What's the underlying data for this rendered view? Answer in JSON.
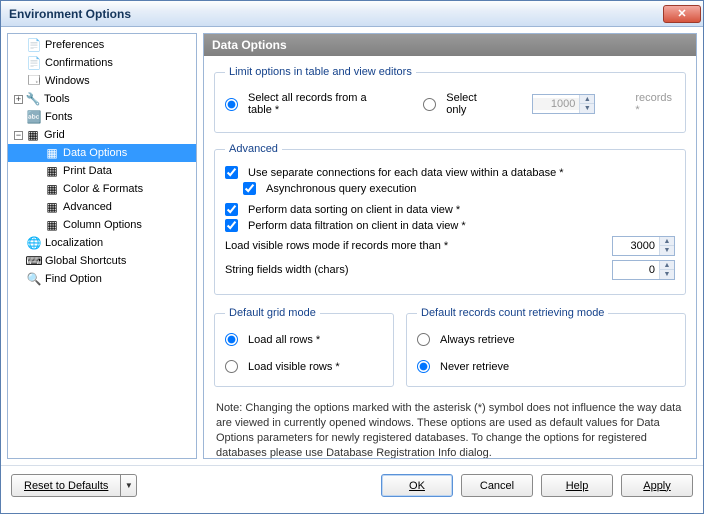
{
  "window": {
    "title": "Environment Options"
  },
  "tree": {
    "items": [
      {
        "label": "Preferences",
        "level": 0,
        "twist": "",
        "icon": "📄"
      },
      {
        "label": "Confirmations",
        "level": 0,
        "twist": "",
        "icon": "📄"
      },
      {
        "label": "Windows",
        "level": 0,
        "twist": "",
        "icon": "🗔"
      },
      {
        "label": "Tools",
        "level": 0,
        "twist": "+",
        "icon": "🔧"
      },
      {
        "label": "Fonts",
        "level": 0,
        "twist": "",
        "icon": "🔤"
      },
      {
        "label": "Grid",
        "level": 0,
        "twist": "−",
        "icon": "▦"
      },
      {
        "label": "Data Options",
        "level": 1,
        "twist": "",
        "icon": "▦",
        "selected": true
      },
      {
        "label": "Print Data",
        "level": 1,
        "twist": "",
        "icon": "▦"
      },
      {
        "label": "Color & Formats",
        "level": 1,
        "twist": "",
        "icon": "▦"
      },
      {
        "label": "Advanced",
        "level": 1,
        "twist": "",
        "icon": "▦"
      },
      {
        "label": "Column Options",
        "level": 1,
        "twist": "",
        "icon": "▦"
      },
      {
        "label": "Localization",
        "level": 0,
        "twist": "",
        "icon": "🌐"
      },
      {
        "label": "Global Shortcuts",
        "level": 0,
        "twist": "",
        "icon": "⌨"
      },
      {
        "label": "Find Option",
        "level": 0,
        "twist": "",
        "icon": "🔍"
      }
    ]
  },
  "panel": {
    "title": "Data Options",
    "limit": {
      "legend": "Limit options in table and view editors",
      "select_all": "Select all records from a table *",
      "select_only": "Select only",
      "select_only_value": "1000",
      "records_suffix": "records *"
    },
    "advanced": {
      "legend": "Advanced",
      "separate_conn": "Use separate connections for each data view within a database *",
      "async_query": "Asynchronous query execution",
      "sort_client": "Perform data sorting on client in data view *",
      "filter_client": "Perform data filtration on client in data view *",
      "load_visible_label": "Load visible rows mode if records more than *",
      "load_visible_value": "3000",
      "string_width_label": "String fields width (chars)",
      "string_width_value": "0"
    },
    "grid_mode": {
      "legend": "Default grid mode",
      "load_all": "Load all rows *",
      "load_visible": "Load visible rows *"
    },
    "retrieve_mode": {
      "legend": "Default records count retrieving mode",
      "always": "Always retrieve",
      "never": "Never retrieve"
    },
    "note": "Note: Changing the options marked with the asterisk (*) symbol does not influence the way data are viewed in currently opened windows. These options are used as default values for Data Options parameters for newly registered databases. To change the options for registered databases please use Database Registration Info dialog."
  },
  "buttons": {
    "reset": "Reset to Defaults",
    "ok": "OK",
    "cancel": "Cancel",
    "help": "Help",
    "apply": "Apply"
  }
}
